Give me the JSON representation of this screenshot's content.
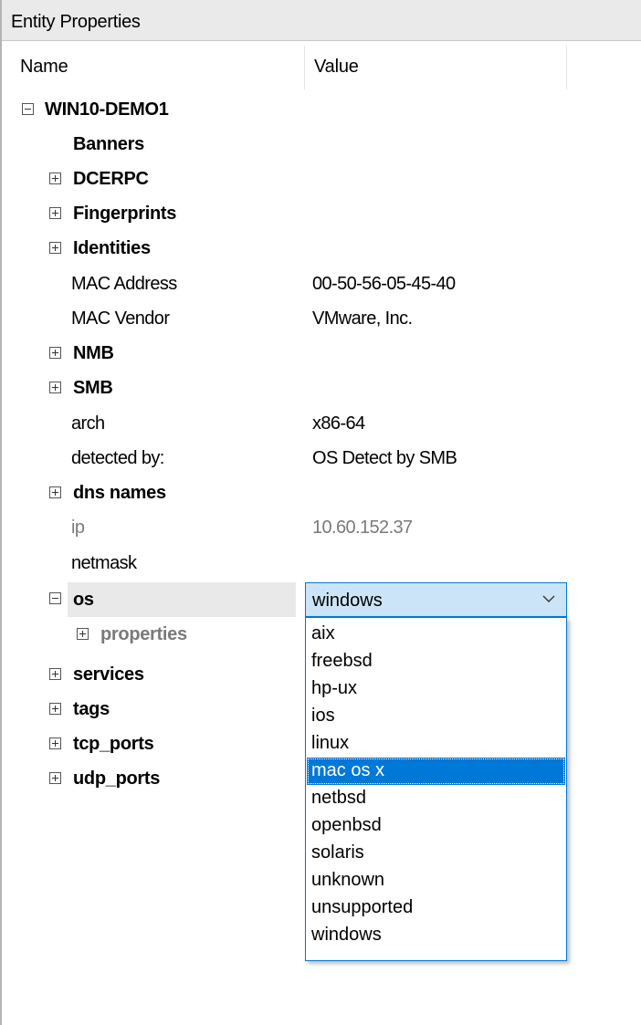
{
  "panel": {
    "title": "Entity Properties"
  },
  "columns": {
    "name": "Name",
    "value": "Value"
  },
  "tree": {
    "root": "WIN10-DEMO1",
    "banners": "Banners",
    "dcerpc": "DCERPC",
    "fingerprints": "Fingerprints",
    "identities": "Identities",
    "mac_address": {
      "label": "MAC Address",
      "value": "00-50-56-05-45-40"
    },
    "mac_vendor": {
      "label": "MAC Vendor",
      "value": "VMware, Inc."
    },
    "nmb": "NMB",
    "smb": "SMB",
    "arch": {
      "label": "arch",
      "value": "x86-64"
    },
    "detected_by": {
      "label": "detected by:",
      "value": "OS Detect by SMB"
    },
    "dns_names": "dns names",
    "ip": {
      "label": "ip",
      "value": "10.60.152.37"
    },
    "netmask": {
      "label": "netmask"
    },
    "os": {
      "label": "os",
      "value": "windows"
    },
    "properties": "properties",
    "services": "services",
    "tags": "tags",
    "tcp_ports": "tcp_ports",
    "udp_ports": "udp_ports"
  },
  "dropdown": {
    "options": [
      "aix",
      "freebsd",
      "hp-ux",
      "ios",
      "linux",
      "mac os x",
      "netbsd",
      "openbsd",
      "solaris",
      "unknown",
      "unsupported",
      "windows"
    ],
    "highlighted": "mac os x"
  },
  "colors": {
    "accent": "#0078d7",
    "combo_bg": "#cce4f7",
    "dim_text": "#7a7a7a"
  },
  "icons": {
    "expand": "plus-box-icon",
    "collapse": "minus-box-icon",
    "combo_arrow": "chevron-down-icon"
  }
}
